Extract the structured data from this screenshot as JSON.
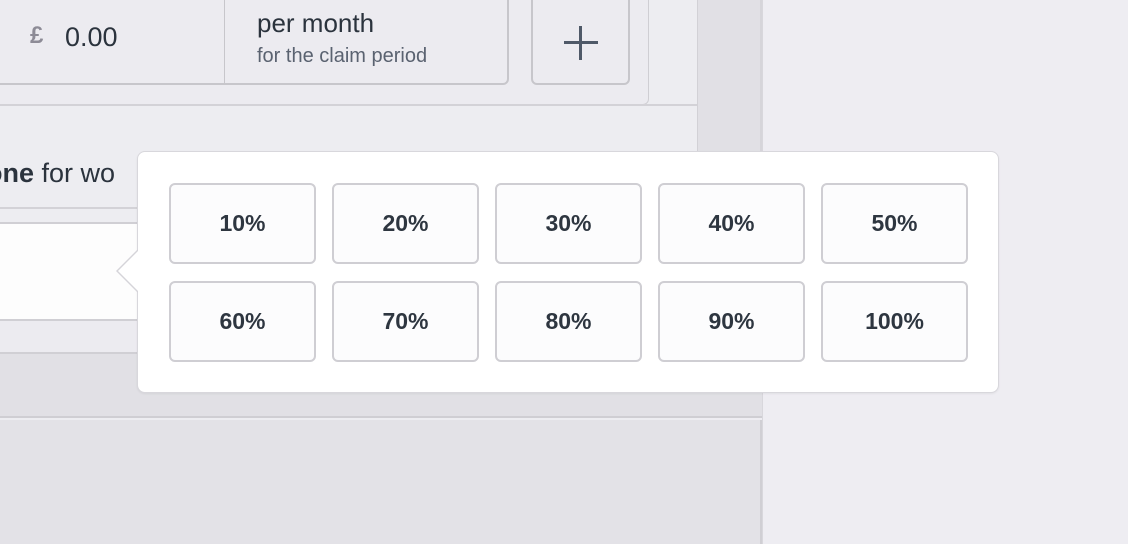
{
  "amount_input": {
    "currency_symbol": "£",
    "value": "0.00",
    "period_title": "per month",
    "period_subtitle": "for the claim period",
    "add_button_icon": "plus-icon"
  },
  "section": {
    "label_bold": "one",
    "label_rest": " for wo"
  },
  "percentage_popover": {
    "options": [
      "10%",
      "20%",
      "30%",
      "40%",
      "50%",
      "60%",
      "70%",
      "80%",
      "90%",
      "100%"
    ]
  },
  "colors": {
    "text_primary": "#2b333d",
    "text_secondary": "#5a6270",
    "currency_symbol": "#8d8b96",
    "popover_bg": "#ffffff",
    "button_border": "#cfced3",
    "page_bg": "#eeedf2"
  }
}
